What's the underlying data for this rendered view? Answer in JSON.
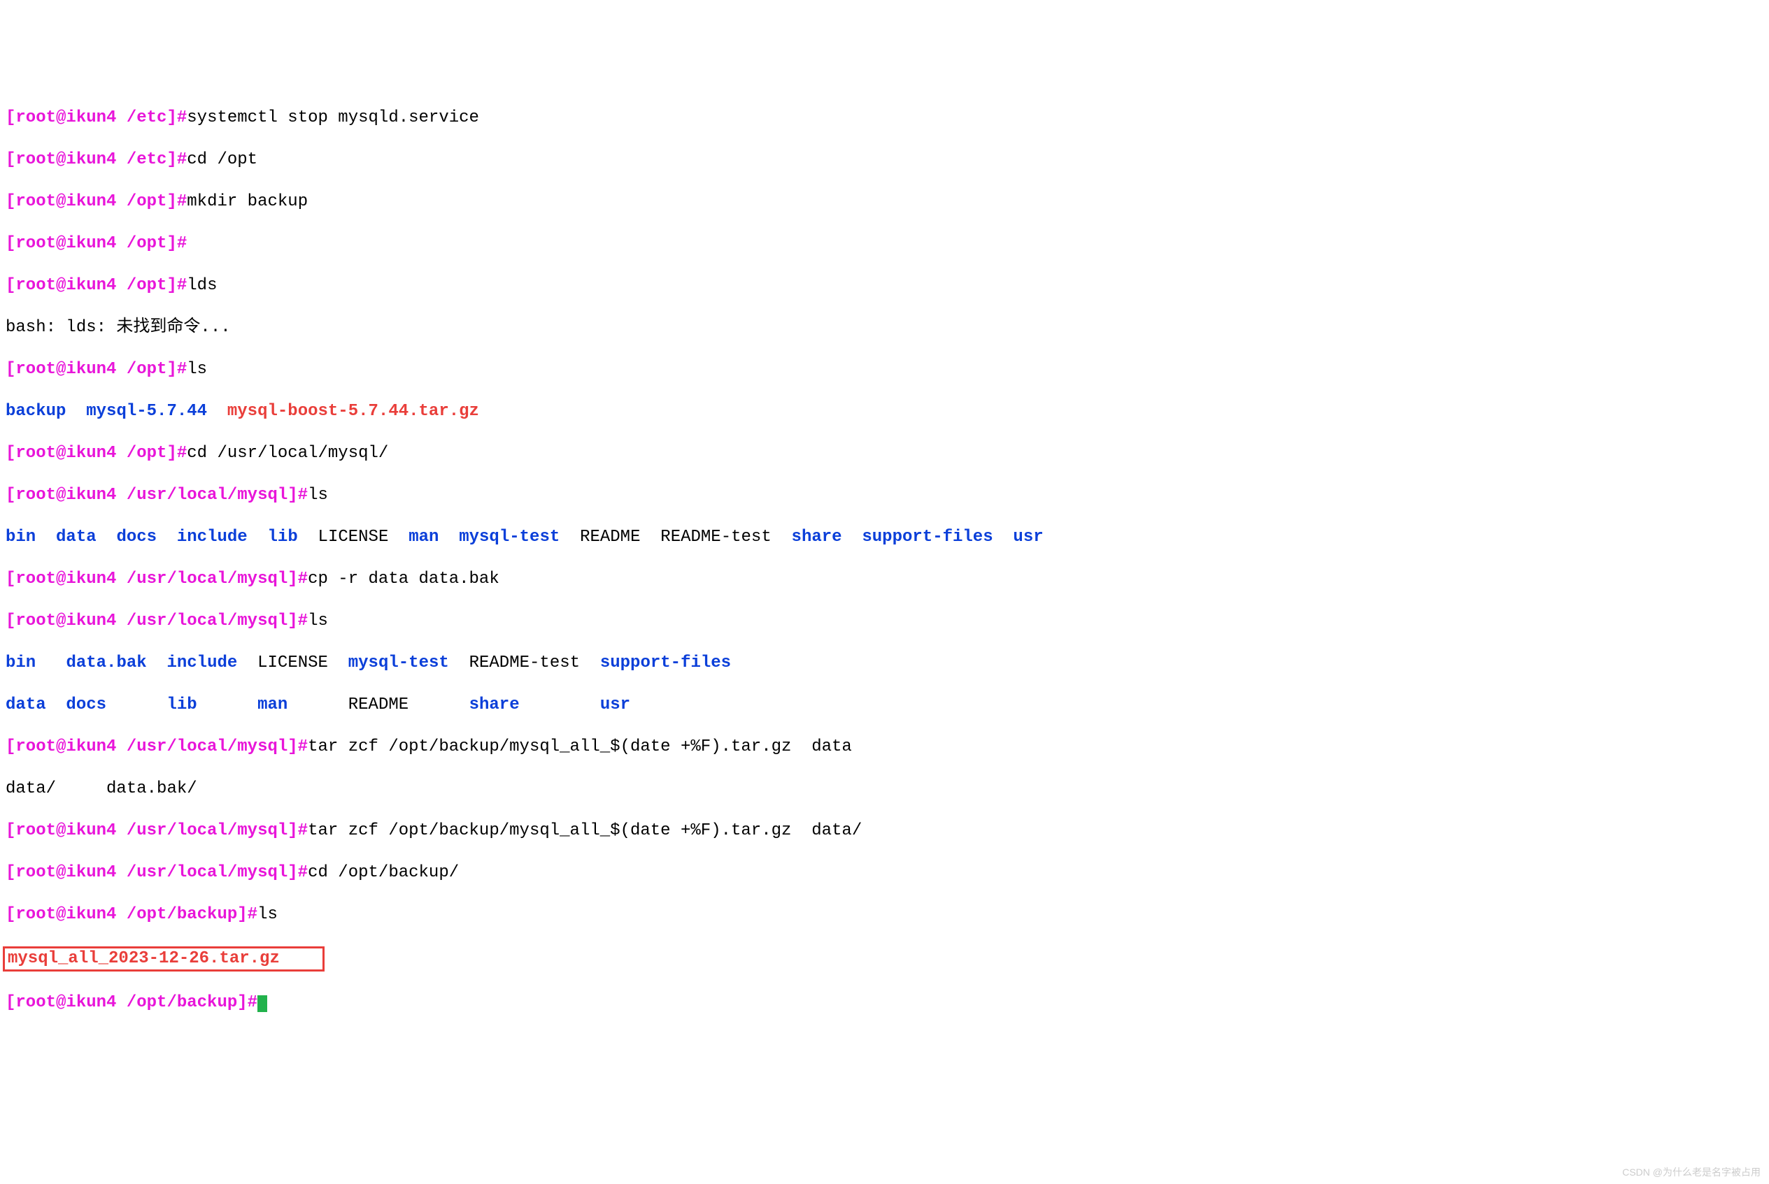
{
  "prompts": {
    "p1": {
      "open": "[",
      "user": "root",
      "at": "@",
      "host": "ikun4",
      "path": " /etc",
      "close": "]#"
    },
    "p2": {
      "open": "[",
      "user": "root",
      "at": "@",
      "host": "ikun4",
      "path": " /etc",
      "close": "]#"
    },
    "p3": {
      "open": "[",
      "user": "root",
      "at": "@",
      "host": "ikun4",
      "path": " /opt",
      "close": "]#"
    },
    "p4": {
      "open": "[",
      "user": "root",
      "at": "@",
      "host": "ikun4",
      "path": " /opt",
      "close": "]#"
    },
    "p5": {
      "open": "[",
      "user": "root",
      "at": "@",
      "host": "ikun4",
      "path": " /opt",
      "close": "]#"
    },
    "p6": {
      "open": "[",
      "user": "root",
      "at": "@",
      "host": "ikun4",
      "path": " /opt",
      "close": "]#"
    },
    "p7": {
      "open": "[",
      "user": "root",
      "at": "@",
      "host": "ikun4",
      "path": " /opt",
      "close": "]#"
    },
    "p8": {
      "open": "[",
      "user": "root",
      "at": "@",
      "host": "ikun4",
      "path": " /usr/local/mysql",
      "close": "]#"
    },
    "p9": {
      "open": "[",
      "user": "root",
      "at": "@",
      "host": "ikun4",
      "path": " /usr/local/mysql",
      "close": "]#"
    },
    "p10": {
      "open": "[",
      "user": "root",
      "at": "@",
      "host": "ikun4",
      "path": " /usr/local/mysql",
      "close": "]#"
    },
    "p11": {
      "open": "[",
      "user": "root",
      "at": "@",
      "host": "ikun4",
      "path": " /usr/local/mysql",
      "close": "]#"
    },
    "p12": {
      "open": "[",
      "user": "root",
      "at": "@",
      "host": "ikun4",
      "path": " /usr/local/mysql",
      "close": "]#"
    },
    "p13": {
      "open": "[",
      "user": "root",
      "at": "@",
      "host": "ikun4",
      "path": " /usr/local/mysql",
      "close": "]#"
    },
    "p14": {
      "open": "[",
      "user": "root",
      "at": "@",
      "host": "ikun4",
      "path": " /opt/backup",
      "close": "]#"
    },
    "p15": {
      "open": "[",
      "user": "root",
      "at": "@",
      "host": "ikun4",
      "path": " /opt/backup",
      "close": "]#"
    }
  },
  "commands": {
    "c1": "systemctl stop mysqld.service",
    "c2": "cd /opt",
    "c3": "mkdir backup",
    "c4": "",
    "c5": "lds",
    "c6": "ls",
    "c7": "cd /usr/local/mysql/",
    "c8": "ls",
    "c9": "cp -r data data.bak",
    "c10": "ls",
    "c11": "tar zcf /opt/backup/mysql_all_$(date +%F).tar.gz  data",
    "c12": "tar zcf /opt/backup/mysql_all_$(date +%F).tar.gz  data/",
    "c13": "cd /opt/backup/",
    "c14": "ls"
  },
  "outputs": {
    "bash_error": "bash: lds: 未找到命令...",
    "ls_opt": {
      "backup": "backup",
      "mysql_dir": "mysql-5.7.44",
      "mysql_archive": "mysql-boost-5.7.44.tar.gz"
    },
    "ls_mysql1": {
      "bin": "bin",
      "data": "data",
      "docs": "docs",
      "include": "include",
      "lib": "lib",
      "license": "LICENSE",
      "man": "man",
      "mysqltest": "mysql-test",
      "readme": "README",
      "readmetest": "README-test",
      "share": "share",
      "supportfiles": "support-files",
      "usr": "usr"
    },
    "ls_mysql2_row1": {
      "bin": "bin",
      "databak": "data.bak",
      "include": "include",
      "license": "LICENSE",
      "mysqltest": "mysql-test",
      "readmetest": "README-test",
      "supportfiles": "support-files"
    },
    "ls_mysql2_row2": {
      "data": "data",
      "docs": "docs",
      "lib": "lib",
      "man": "man",
      "readme": "README",
      "share": "share",
      "usr": "usr"
    },
    "tab_completion": {
      "data": "data/",
      "databak": "data.bak/"
    },
    "backup_file": "mysql_all_2023-12-26.tar.gz"
  },
  "watermark": "CSDN @为什么老是名字被占用"
}
